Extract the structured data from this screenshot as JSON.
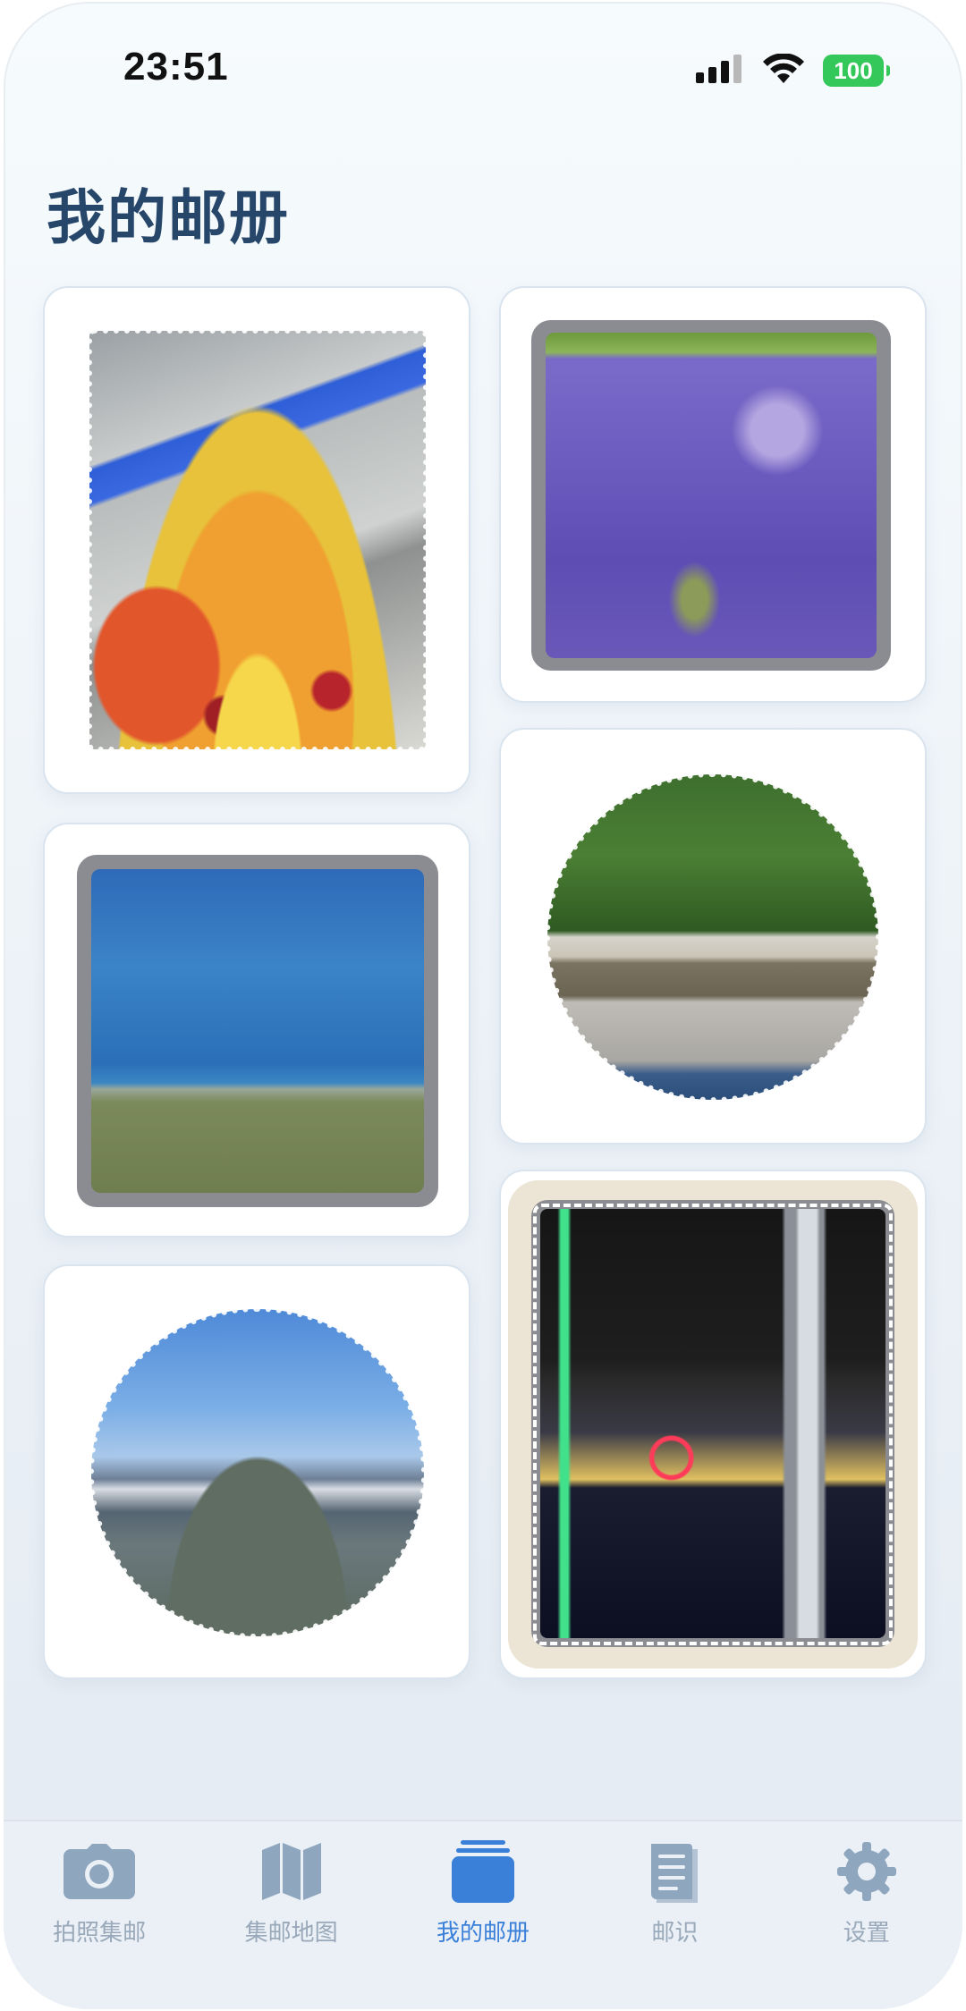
{
  "status_bar": {
    "time": "23:51",
    "battery": "100"
  },
  "page": {
    "title": "我的邮册"
  },
  "tabs": [
    {
      "label": "拍照集邮",
      "icon": "camera-icon"
    },
    {
      "label": "集邮地图",
      "icon": "map-icon"
    },
    {
      "label": "我的邮册",
      "icon": "album-icon",
      "active": true
    },
    {
      "label": "邮识",
      "icon": "book-icon"
    },
    {
      "label": "设置",
      "icon": "gear-icon"
    }
  ],
  "stamps": [
    {
      "name": "stained-glass-lamp",
      "shape": "rectangle-perforated"
    },
    {
      "name": "lavender-field",
      "shape": "rectangle-gray-frame"
    },
    {
      "name": "sea-shore",
      "shape": "rectangle-gray-frame"
    },
    {
      "name": "forest-boathouse",
      "shape": "circle-perforated"
    },
    {
      "name": "mountain-lake",
      "shape": "circle-perforated"
    },
    {
      "name": "night-city-skyline",
      "shape": "rectangle-decorated-frame"
    }
  ],
  "colors": {
    "accent": "#3b80d8",
    "title": "#27476a",
    "inactive": "#9aa9ba",
    "battery": "#34c759"
  }
}
